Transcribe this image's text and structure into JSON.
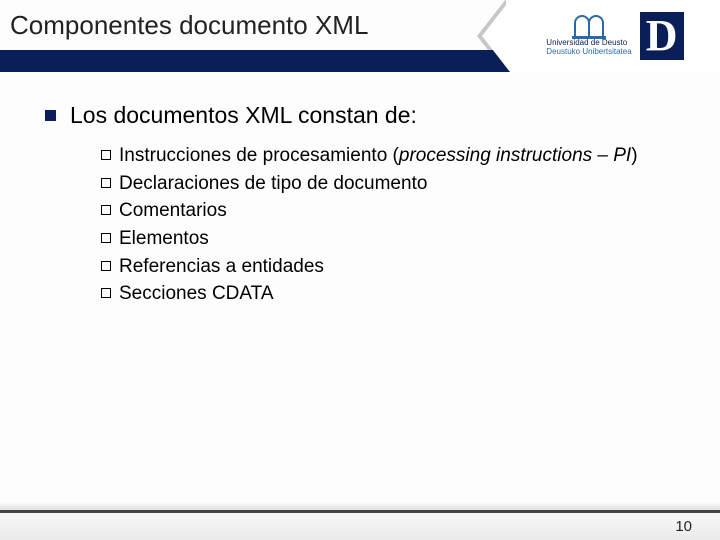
{
  "header": {
    "title": "Componentes documento XML",
    "logo": {
      "line1": "Universidad de Deusto",
      "line2": "Deustuko Unibertsitatea",
      "letter": "D"
    }
  },
  "content": {
    "main": "Los documentos XML constan de:",
    "items": [
      {
        "pre": "Instrucciones de procesamiento (",
        "em": "processing instructions – PI",
        "post": ")"
      },
      {
        "pre": "Declaraciones de tipo de documento",
        "em": "",
        "post": ""
      },
      {
        "pre": "Comentarios",
        "em": "",
        "post": ""
      },
      {
        "pre": "Elementos",
        "em": "",
        "post": ""
      },
      {
        "pre": "Referencias a entidades",
        "em": "",
        "post": ""
      },
      {
        "pre": "Secciones CDATA",
        "em": "",
        "post": ""
      }
    ]
  },
  "footer": {
    "page": "10"
  }
}
